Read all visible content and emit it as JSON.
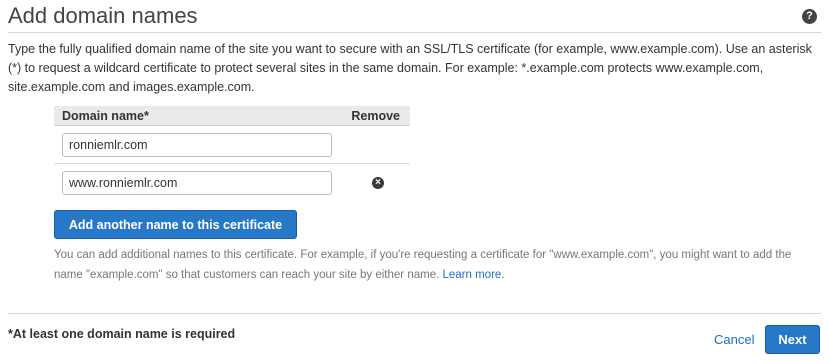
{
  "header": {
    "title": "Add domain names",
    "help_icon": "?"
  },
  "intro_text": "Type the fully qualified domain name of the site you want to secure with an SSL/TLS certificate (for example, www.example.com). Use an asterisk (*) to request a wildcard certificate to protect several sites in the same domain. For example: *.example.com protects www.example.com, site.example.com and images.example.com.",
  "table": {
    "col_domain": "Domain name*",
    "col_remove": "Remove",
    "rows": [
      {
        "value": "ronniemlr.com",
        "removable": false
      },
      {
        "value": "www.ronniemlr.com",
        "removable": true
      }
    ],
    "remove_icon": "close-circle-icon"
  },
  "add_button_label": "Add another name to this certificate",
  "helper": {
    "text": "You can add additional names to this certificate. For example, if you're requesting a certificate for \"www.example.com\", you might want to add the name \"example.com\" so that customers can reach your site by either name.",
    "link": "Learn more."
  },
  "footer": {
    "required_note": "*At least one domain name is required",
    "cancel_label": "Cancel",
    "next_label": "Next"
  },
  "colors": {
    "primary_button": "#2878c8",
    "link": "#1f6fc2"
  }
}
